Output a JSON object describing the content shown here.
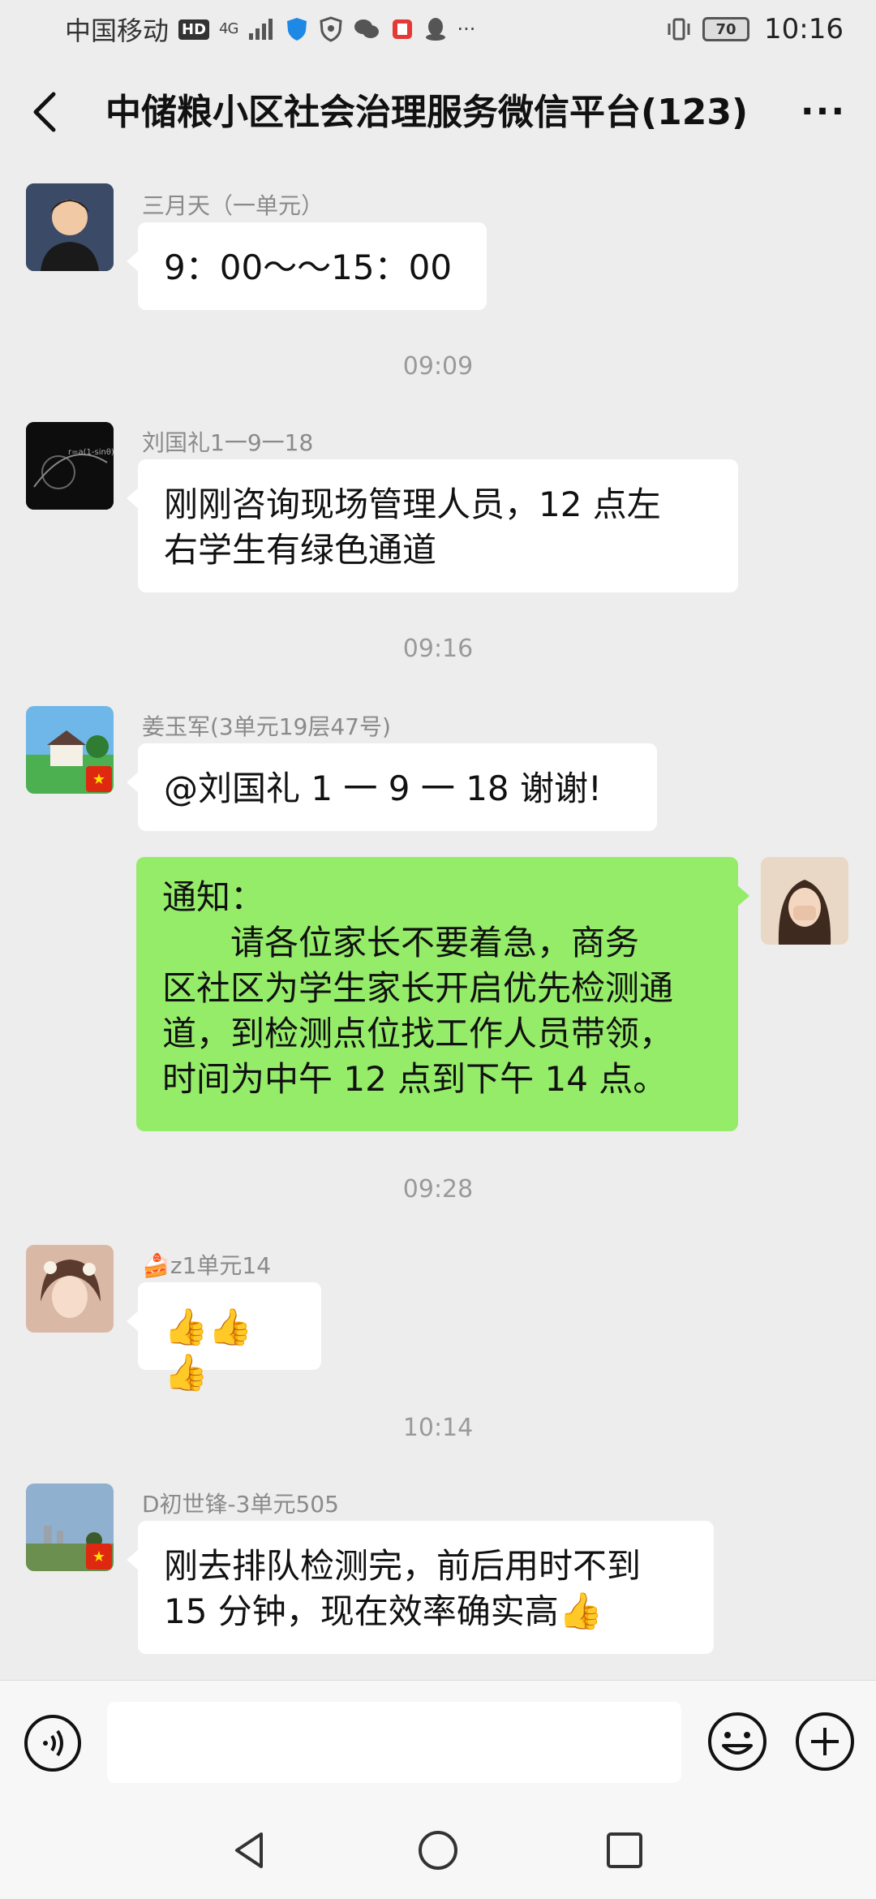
{
  "status_bar": {
    "carrier": "中国移动",
    "hd": "HD",
    "network": "4G",
    "battery": "70",
    "time": "10:16"
  },
  "header": {
    "title": "中储粮小区社会治理服务微信平台(123)"
  },
  "messages": [
    {
      "sender": "三月天（一单元）",
      "text": "9：00～～15：00"
    },
    {
      "sender": "刘国礼1一9一18",
      "lines": [
        "刚刚咨询现场管理人员，12 点左",
        "右学生有绿色通道"
      ]
    },
    {
      "sender": "姜玉军(3单元19层47号)",
      "text": "@刘国礼 1 一 9 一 18  谢谢!"
    },
    {
      "lines": [
        "通知：",
        "　　请各位家长不要着急，商务",
        "区社区为学生家长开启优先检测通",
        "道，到检测点位找工作人员带领，",
        "时间为中午 12 点到下午 14 点。"
      ]
    },
    {
      "sender_prefix": "🍰",
      "sender": "z1单元14",
      "text": "👍👍👍"
    },
    {
      "sender": "D初世锋-3单元505",
      "lines": [
        "刚去排队检测完，前后用时不到",
        "15 分钟，现在效率确实高"
      ],
      "suffix": "👍"
    }
  ],
  "timestamps": [
    "09:09",
    "09:16",
    "09:28",
    "10:14"
  ],
  "input": {
    "placeholder": ""
  },
  "colors": {
    "background": "#ededed",
    "self_bubble": "#95ec69",
    "other_bubble": "#ffffff"
  }
}
